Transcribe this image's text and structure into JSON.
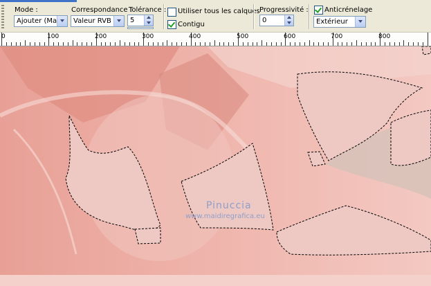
{
  "toolbar": {
    "mode": {
      "label": "Mode :",
      "value": "Ajouter (Maj)"
    },
    "match": {
      "label": "Correspondance :",
      "value": "Valeur RVB"
    },
    "tolerance": {
      "label": "Tolérance :",
      "value": "5"
    },
    "use_all_layers": {
      "label": "Utiliser tous les calques",
      "checked": false
    },
    "contiguous": {
      "label": "Contigu",
      "checked": true
    },
    "feather": {
      "label": "Progressivité :",
      "value": "0"
    },
    "antialias": {
      "label": "Anticrénelage",
      "checked": true,
      "mode": "Extérieur"
    }
  },
  "ruler": {
    "labels": [
      "0",
      "100",
      "200",
      "300",
      "400",
      "500",
      "600",
      "700",
      "800"
    ]
  },
  "watermark": {
    "title": "Pinuccia",
    "url": "www.maidiregrafica.eu"
  },
  "colors": {
    "toolbar_bg": "#ece9d8",
    "canvas_pink": "#e9a9a0",
    "selection_fill": "#eec8c3"
  },
  "icons": {
    "dropdown": "chevron-down-icon",
    "spinner": "spin-arrows-icon",
    "checkbox": "checkmark-icon"
  }
}
